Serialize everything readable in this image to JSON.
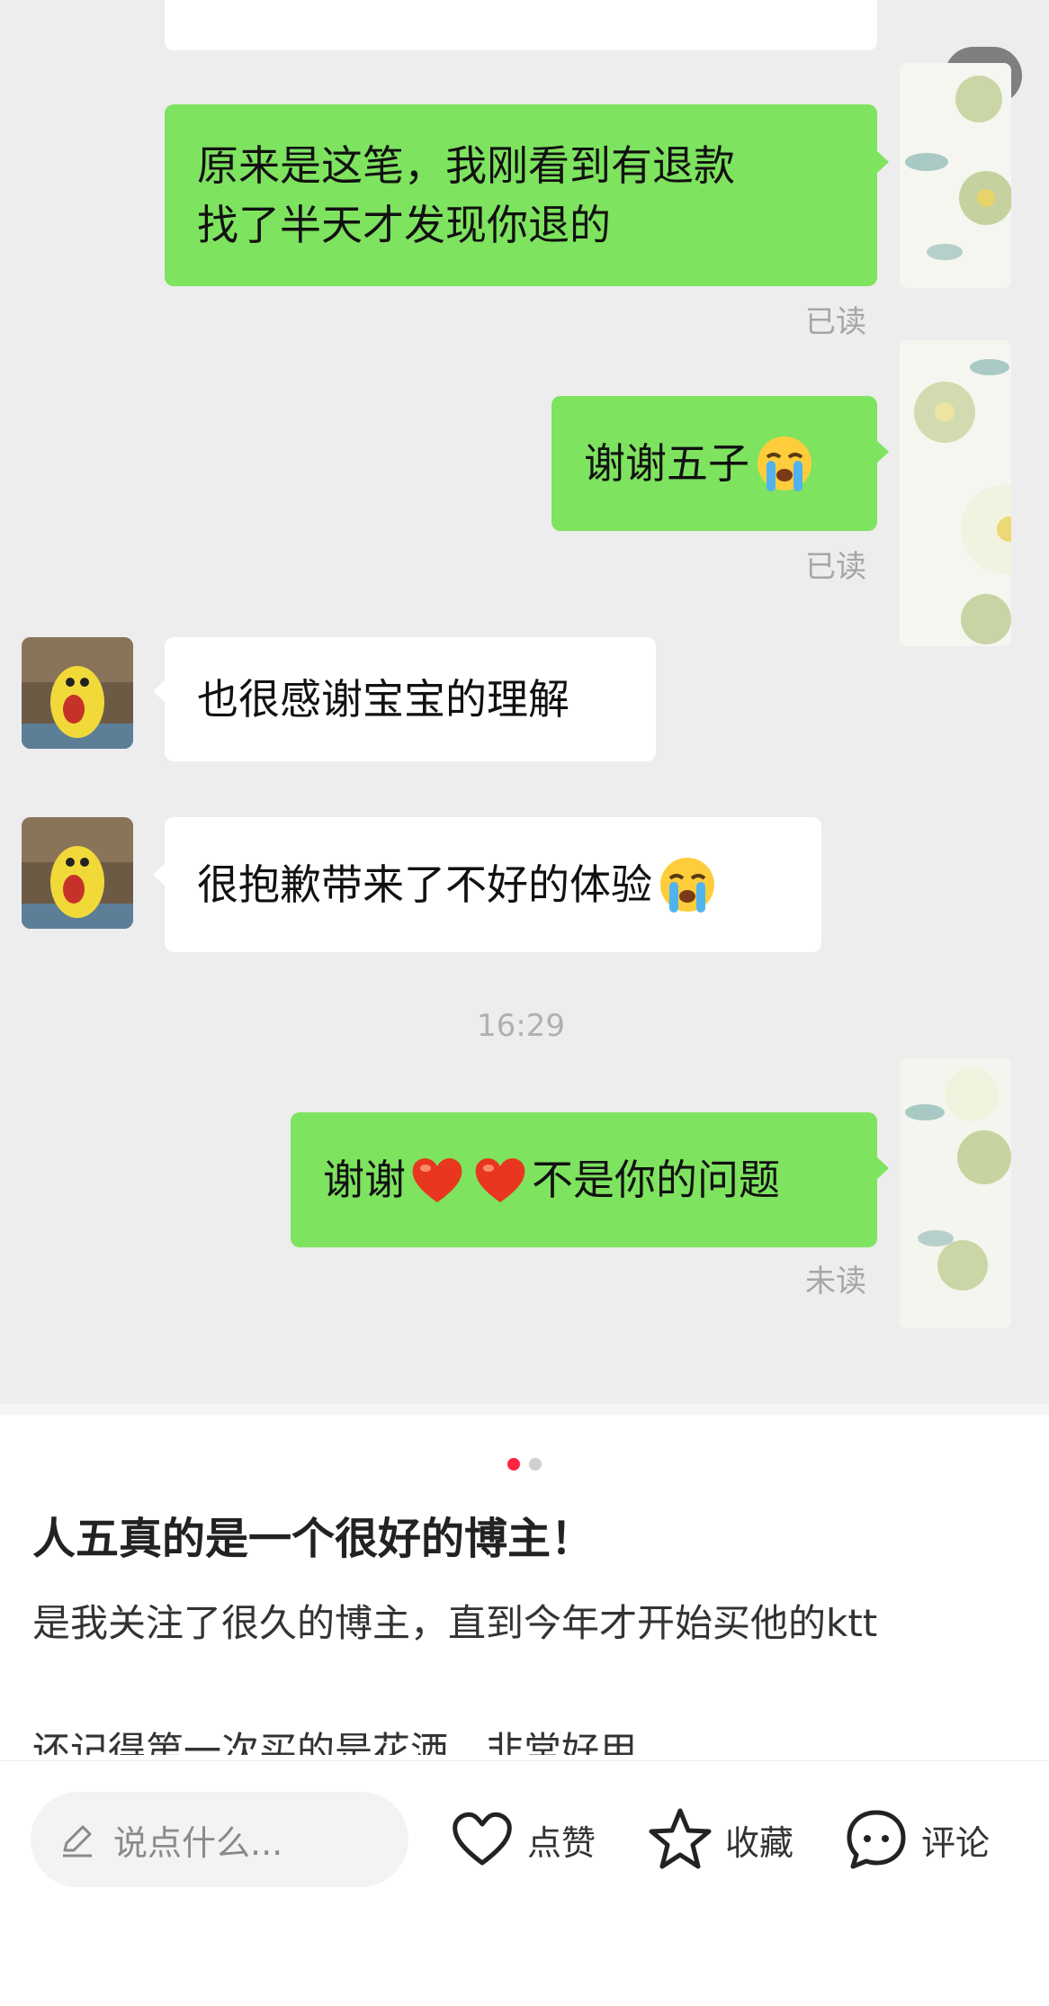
{
  "chat": {
    "page_indicator": "1/2",
    "messages": [
      {
        "side": "mine",
        "lines": [
          "原来是这笔，我刚看到有退款",
          "找了半天才发现你退的"
        ],
        "status": "已读"
      },
      {
        "side": "mine",
        "text": "谢谢五子",
        "emoji": "crying-face-icon",
        "status": "已读"
      },
      {
        "side": "theirs",
        "text": "也很感谢宝宝的理解"
      },
      {
        "side": "theirs",
        "text": "很抱歉带来了不好的体验",
        "emoji": "crying-face-icon"
      },
      {
        "time": "16:29"
      },
      {
        "side": "mine",
        "text_a": "谢谢",
        "text_b": "不是你的问题",
        "emoji": "red-heart-icon",
        "status": "未读"
      }
    ]
  },
  "post": {
    "title": "人五真的是一个很好的博主！",
    "body_line1": "是我关注了很久的博主，直到今年才开始买他的ktt",
    "body_line2": "还记得第一次买的是花洒，非常好用"
  },
  "bottom_bar": {
    "comment_placeholder": "说点什么...",
    "like_label": "点赞",
    "collect_label": "收藏",
    "comment_label": "评论"
  },
  "colors": {
    "my_bubble": "#7ee35f",
    "chat_bg": "#ededed",
    "accent": "#ff2442"
  }
}
